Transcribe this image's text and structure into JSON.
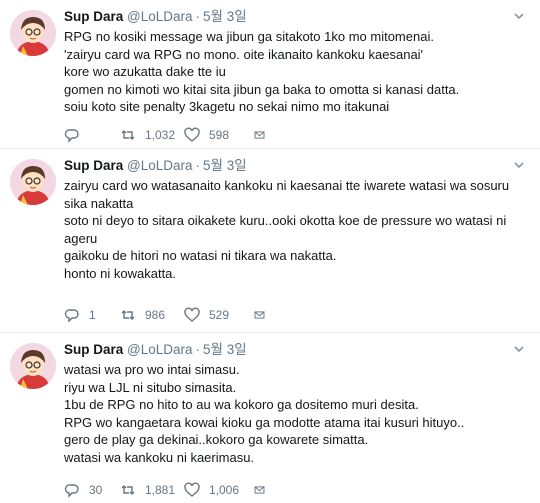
{
  "tweets": [
    {
      "name": "Sup Dara",
      "handle": "@LoLDara",
      "dot": "·",
      "time": "5월 3일",
      "lines": [
        "RPG no kosiki message wa jibun ga sitakoto 1ko mo mitomenai.",
        "'zairyu card wa RPG no mono. oite ikanaito kankoku kaesanai'",
        "kore wo azukatta dake tte iu",
        "gomen no kimoti wo kitai sita jibun ga baka to omotta si kanasi datta.",
        "soiu koto site penalty 3kagetu no sekai nimo mo itakunai"
      ],
      "replies": "",
      "retweets": "1,032",
      "likes": "598"
    },
    {
      "name": "Sup Dara",
      "handle": "@LoLDara",
      "dot": "·",
      "time": "5월 3일",
      "lines": [
        "zairyu card wo watasanaito kankoku ni kaesanai tte iwarete watasi wa sosuru sika nakatta",
        "soto ni deyo to sitara oikakete kuru..ooki okotta koe de pressure wo watasi ni ageru",
        "gaikoku de hitori no watasi ni tikara wa nakatta.",
        "honto ni kowakatta."
      ],
      "replies": "1",
      "retweets": "986",
      "likes": "529"
    },
    {
      "name": "Sup Dara",
      "handle": "@LoLDara",
      "dot": "·",
      "time": "5월 3일",
      "lines": [
        "watasi wa pro wo intai simasu.",
        "riyu wa LJL ni situbo simasita.",
        "1bu de RPG no hito to au wa kokoro ga dositemo muri desita.",
        "RPG wo kangaetara kowai kioku ga modotte atama itai kusuri hituyo..",
        "gero de play ga dekinai..kokoro ga kowarete simatta.",
        "watasi wa kankoku ni kaerimasu."
      ],
      "replies": "30",
      "retweets": "1,881",
      "likes": "1,006"
    }
  ],
  "icons": {
    "reply": "reply-icon",
    "retweet": "retweet-icon",
    "like": "heart-icon",
    "dm": "envelope-icon",
    "caret": "chevron-down-icon"
  },
  "colors": {
    "text": "#14171a",
    "muted": "#657786",
    "divider": "#e6ecf0",
    "avatar_bg": "#f3d7e2"
  }
}
